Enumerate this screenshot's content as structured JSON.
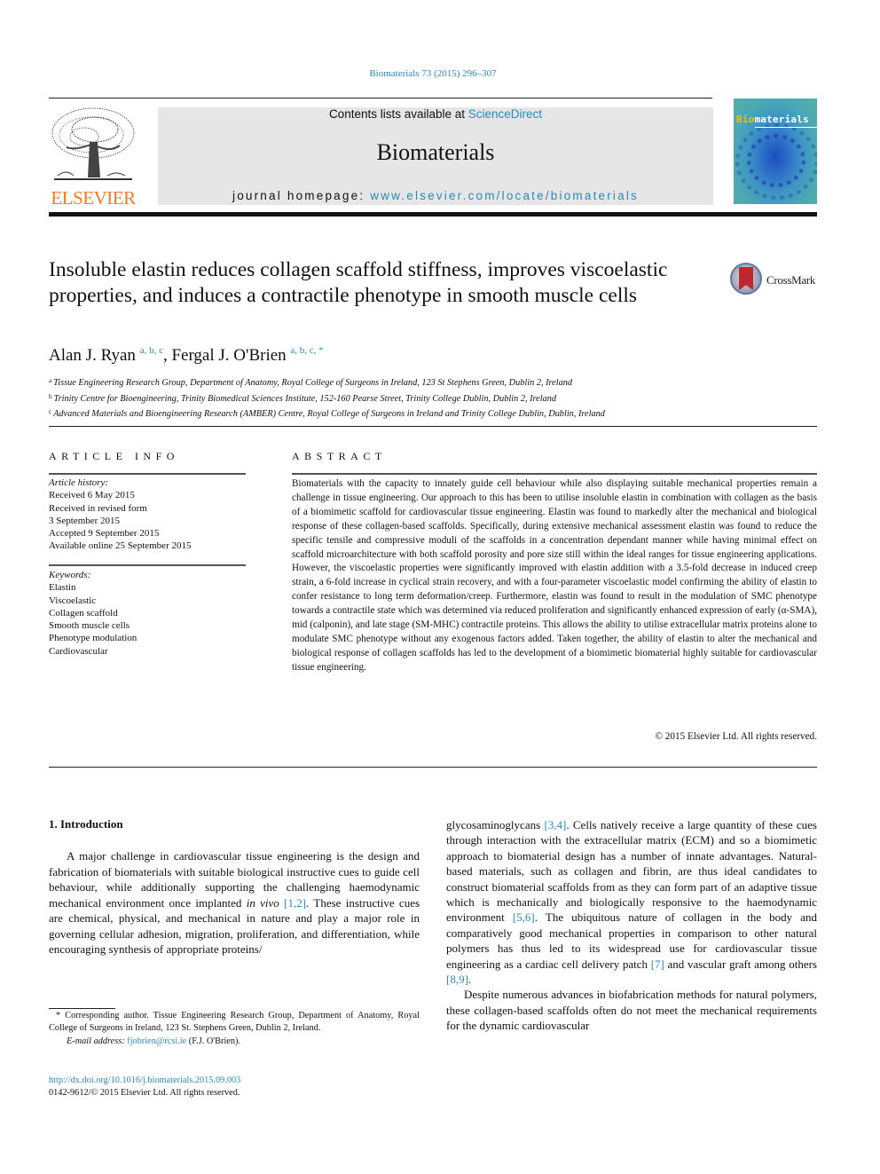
{
  "header": {
    "citation": "Biomaterials 73 (2015) 296–307",
    "contents_prefix": "Contents lists available at ",
    "contents_link": "ScienceDirect",
    "journal_name": "Biomaterials",
    "homepage_prefix": "journal homepage: ",
    "homepage_link": "www.elsevier.com/locate/biomaterials",
    "publisher_logo": "ELSEVIER",
    "cover_title_highlight": "Bio",
    "cover_title_rest": "materials",
    "accent_color": "#2a8ab5",
    "publisher_color": "#f47920"
  },
  "article": {
    "title": "Insoluble elastin reduces collagen scaffold stiffness, improves viscoelastic properties, and induces a contractile phenotype in smooth muscle cells",
    "crossmark_label": "CrossMark",
    "authors": [
      {
        "name": "Alan J. Ryan",
        "affil": "a, b, c"
      },
      {
        "name": "Fergal J. O'Brien",
        "affil": "a, b, c, *"
      }
    ],
    "affiliations": [
      {
        "key": "a",
        "text": "Tissue Engineering Research Group, Department of Anatomy, Royal College of Surgeons in Ireland, 123 St Stephens Green, Dublin 2, Ireland"
      },
      {
        "key": "b",
        "text": "Trinity Centre for Bioengineering, Trinity Biomedical Sciences Institute, 152-160 Pearse Street, Trinity College Dublin, Dublin 2, Ireland"
      },
      {
        "key": "c",
        "text": "Advanced Materials and Bioengineering Research (AMBER) Centre, Royal College of Surgeons in Ireland and Trinity College Dublin, Dublin, Ireland"
      }
    ]
  },
  "article_info": {
    "heading": "ARTICLE INFO",
    "history_label": "Article history:",
    "history": [
      "Received 6 May 2015",
      "Received in revised form",
      "3 September 2015",
      "Accepted 9 September 2015",
      "Available online 25 September 2015"
    ],
    "keywords_label": "Keywords:",
    "keywords": [
      "Elastin",
      "Viscoelastic",
      "Collagen scaffold",
      "Smooth muscle cells",
      "Phenotype modulation",
      "Cardiovascular"
    ]
  },
  "abstract": {
    "heading": "ABSTRACT",
    "text": "Biomaterials with the capacity to innately guide cell behaviour while also displaying suitable mechanical properties remain a challenge in tissue engineering. Our approach to this has been to utilise insoluble elastin in combination with collagen as the basis of a biomimetic scaffold for cardiovascular tissue engineering. Elastin was found to markedly alter the mechanical and biological response of these collagen-based scaffolds. Specifically, during extensive mechanical assessment elastin was found to reduce the specific tensile and compressive moduli of the scaffolds in a concentration dependant manner while having minimal effect on scaffold microarchitecture with both scaffold porosity and pore size still within the ideal ranges for tissue engineering applications. However, the viscoelastic properties were significantly improved with elastin addition with a 3.5-fold decrease in induced creep strain, a 6-fold increase in cyclical strain recovery, and with a four-parameter viscoelastic model confirming the ability of elastin to confer resistance to long term deformation/creep. Furthermore, elastin was found to result in the modulation of SMC phenotype towards a contractile state which was determined via reduced proliferation and significantly enhanced expression of early (α-SMA), mid (calponin), and late stage (SM-MHC) contractile proteins. This allows the ability to utilise extracellular matrix proteins alone to modulate SMC phenotype without any exogenous factors added. Taken together, the ability of elastin to alter the mechanical and biological response of collagen scaffolds has led to the development of a biomimetic biomaterial highly suitable for cardiovascular tissue engineering.",
    "copyright": "© 2015 Elsevier Ltd. All rights reserved."
  },
  "intro": {
    "heading": "1.  Introduction",
    "col1": {
      "t1": "A major challenge in cardiovascular tissue engineering is the design and fabrication of biomaterials with suitable biological instructive cues to guide cell behaviour, while additionally supporting the challenging haemodynamic mechanical environment once implanted ",
      "t1_italic": "in vivo",
      "ref1": "[1,2]",
      "t2": ". These instructive cues are chemical, physical, and mechanical in nature and play a major role in governing cellular adhesion, migration, proliferation, and differentiation, while encouraging synthesis of appropriate proteins/"
    },
    "col2": {
      "t1": "glycosaminoglycans ",
      "ref1": "[3,4]",
      "t2": ". Cells natively receive a large quantity of these cues through interaction with the extracellular matrix (ECM) and so a biomimetic approach to biomaterial design has a number of innate advantages. Natural-based materials, such as collagen and fibrin, are thus ideal candidates to construct biomaterial scaffolds from as they can form part of an adaptive tissue which is mechanically and biologically responsive to the haemodynamic environment ",
      "ref2": "[5,6]",
      "t3": ". The ubiquitous nature of collagen in the body and comparatively good mechanical properties in comparison to other natural polymers has thus led to its widespread use for cardiovascular tissue engineering as a cardiac cell delivery patch ",
      "ref3": "[7]",
      "t4": " and vascular graft among others ",
      "ref4": "[8,9]",
      "t5": ".",
      "p2": "Despite numerous advances in biofabrication methods for natural polymers, these collagen-based scaffolds often do not meet the mechanical requirements for the dynamic cardiovascular"
    }
  },
  "footnote": {
    "corresponding": "* Corresponding author. Tissue Engineering Research Group, Department of Anatomy, Royal College of Surgeons in Ireland, 123 St. Stephens Green, Dublin 2, Ireland.",
    "email_label": "E-mail address: ",
    "email": "fjobrien@rcsi.ie",
    "email_suffix": " (F.J. O'Brien).",
    "doi": "http://dx.doi.org/10.1016/j.biomaterials.2015.09.003",
    "issn": "0142-9612/© 2015 Elsevier Ltd. All rights reserved."
  }
}
